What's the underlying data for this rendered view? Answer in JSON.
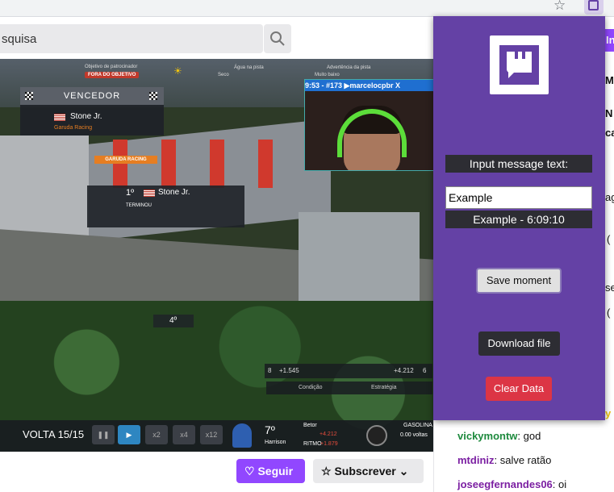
{
  "browser": {
    "ext_icon": "twitch-extension-icon",
    "star_icon": "star-icon"
  },
  "header": {
    "search_placeholder_fragment": "squisa",
    "edge_button_fragment": "In"
  },
  "video": {
    "hud_top": {
      "sponsor_label": "Objetivo de patrocinador",
      "sponsor_status": "FORA DO OBJETIVO",
      "track_water_label": "Água na pista",
      "weather_value": "Seco",
      "track_warning_label": "Advertência da pista",
      "track_value": "Muito baixo"
    },
    "winner": {
      "title": "VENCEDOR",
      "driver": "Stone Jr.",
      "team": "Garuda Racing"
    },
    "position_card": {
      "position": "1º",
      "driver": "Stone Jr.",
      "status": "TERMINOU",
      "team": "GARUDA RACING"
    },
    "webcam_overlay": "9:53 - #173 ▶marcelocpbr X",
    "marker_position": "4º",
    "gap_bar": {
      "left_pos": "8",
      "left_gap": "+1.545",
      "right_gap": "+4.212",
      "right_pos": "6"
    },
    "strategy_bar": {
      "condition": "Condição",
      "strategy": "Estratégia"
    },
    "bottom": {
      "lap": "VOLTA 15/15",
      "speed_1": "x2",
      "speed_2": "x4",
      "speed_3": "x12",
      "position": "7º",
      "driver": "Harrison",
      "best_label": "Betor",
      "best_value": "+4.212",
      "rhythm_label": "RITMO",
      "rhythm_value": "+1.879",
      "fuel_label": "GASOLINA",
      "fuel_value": "0.00 voltas"
    }
  },
  "actions": {
    "follow_label": "Seguir",
    "subscribe_label": "Subscrever"
  },
  "chat": {
    "fragments": [
      "MI",
      "N",
      "ca",
      "ag",
      "(",
      "se",
      "("
    ],
    "messages": [
      {
        "user": "vickymontw",
        "text": ": god",
        "user_color": "#1e8a3e"
      },
      {
        "user": "mtdiniz",
        "text": ": salve ratão",
        "user_color": "#7b1fa2"
      },
      {
        "user": "joseegfernandes06",
        "text": ": oi",
        "user_color": "#7b1fa2"
      }
    ]
  },
  "popup": {
    "input_label": "Input message text:",
    "input_value": "Example",
    "preview": "Example - 6:09:10",
    "save_label": "Save moment",
    "download_label": "Download file",
    "clear_label": "Clear Data"
  },
  "colors": {
    "twitch_purple": "#6441a5",
    "follow_purple": "#9147ff",
    "danger": "#dc3545"
  }
}
